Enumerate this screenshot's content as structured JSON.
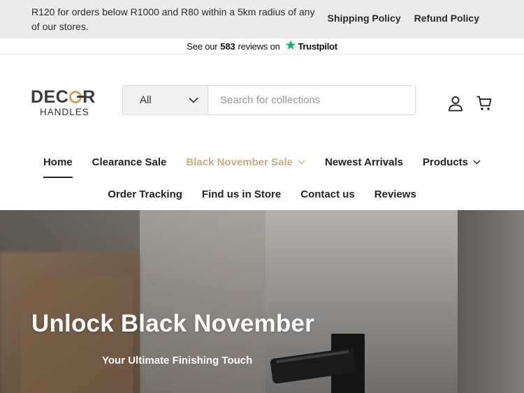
{
  "announcement": {
    "message": "R120 for orders below R1000 and R80 within a 5km radius of any of our stores.",
    "links": [
      "Shipping Policy",
      "Refund Policy"
    ]
  },
  "trustpilot": {
    "prefix": "See our",
    "count": "583",
    "suffix": "reviews on",
    "brand": "Trustpilot",
    "star_icon": "trustpilot-star-icon",
    "star_color": "#00b67a"
  },
  "logo": {
    "line1": "DECOR",
    "line2": "HANDLES",
    "accent_color": "#c9a35f"
  },
  "search": {
    "category_selected": "All",
    "placeholder": "Search for collections",
    "value": ""
  },
  "header_icons": [
    "account-icon",
    "cart-icon"
  ],
  "nav": {
    "row1": [
      {
        "label": "Home",
        "active": true,
        "dropdown": false
      },
      {
        "label": "Clearance Sale",
        "active": false,
        "dropdown": false
      },
      {
        "label": "Black November Sale",
        "active": false,
        "dropdown": true,
        "highlight": true
      },
      {
        "label": "Newest Arrivals",
        "active": false,
        "dropdown": false
      },
      {
        "label": "Products",
        "active": false,
        "dropdown": true
      }
    ],
    "row2": [
      {
        "label": "Order Tracking"
      },
      {
        "label": "Find us in Store"
      },
      {
        "label": "Contact us"
      },
      {
        "label": "Reviews"
      }
    ],
    "sale_color": "#c4ae85"
  },
  "hero": {
    "title": "Unlock Black November",
    "subtitle": "Your Ultimate Finishing Touch"
  }
}
